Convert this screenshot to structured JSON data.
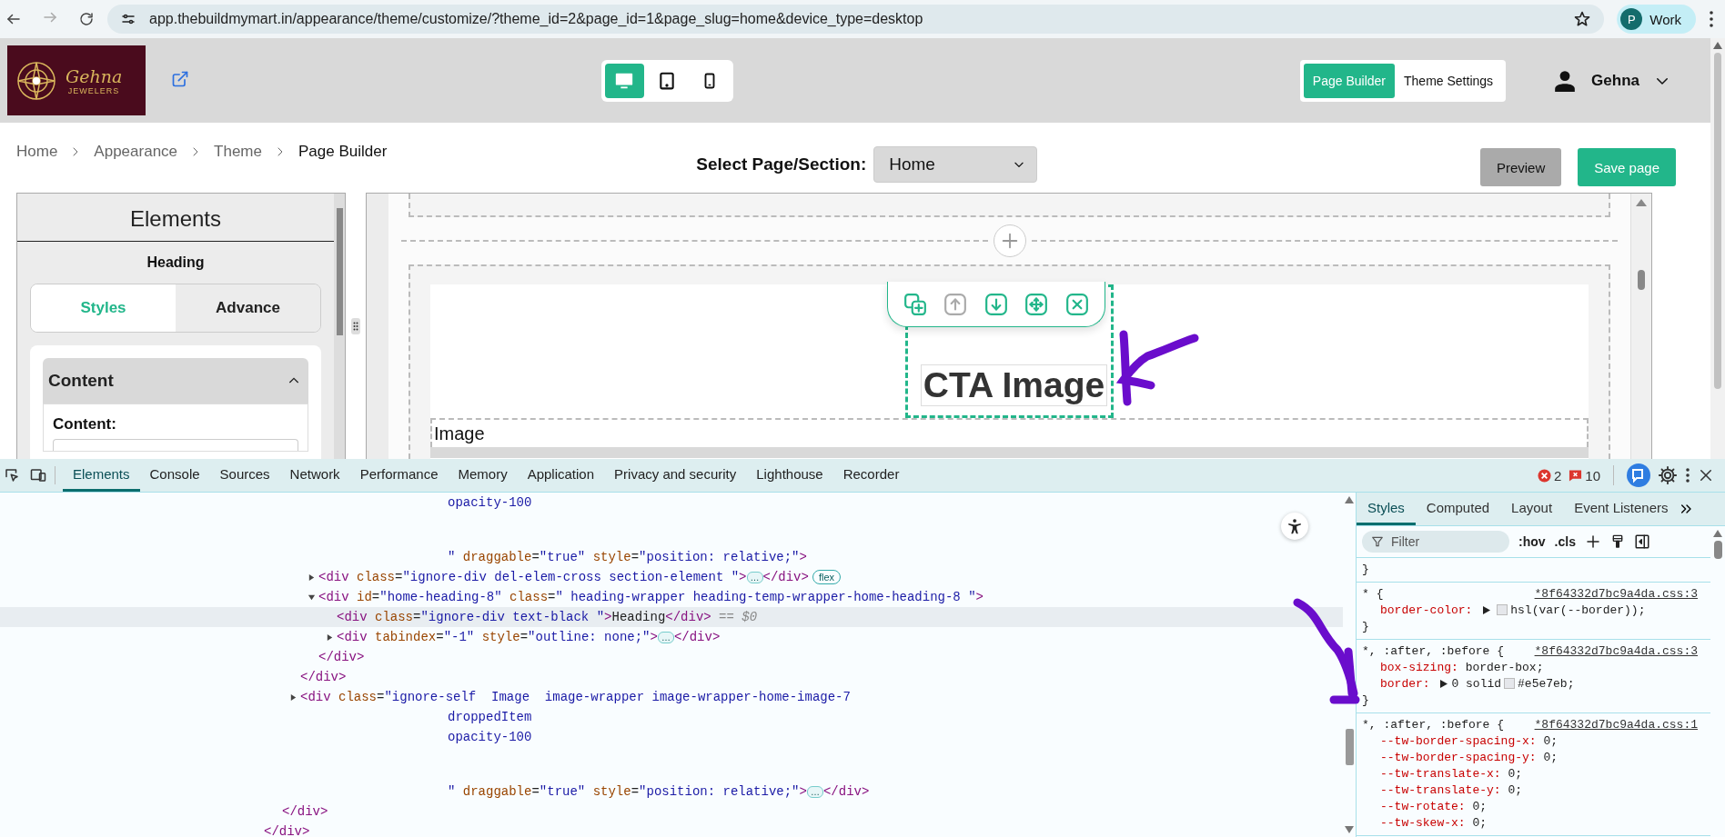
{
  "browser": {
    "url": "app.thebuildmymart.in/appearance/theme/customize/?theme_id=2&page_id=1&page_slug=home&device_type=desktop",
    "profile_initial": "P",
    "profile_label": "Work"
  },
  "header": {
    "logo_name": "Gehna",
    "logo_tagline": "JEWELERS",
    "devices": [
      {
        "kind": "desktop",
        "selected": true
      },
      {
        "kind": "tablet",
        "selected": false
      },
      {
        "kind": "mobile",
        "selected": false
      }
    ],
    "modes": [
      {
        "label": "Page Builder",
        "selected": true
      },
      {
        "label": "Theme Settings",
        "selected": false
      }
    ],
    "user": "Gehna"
  },
  "breadcrumb": [
    {
      "label": "Home",
      "current": false
    },
    {
      "label": "Appearance",
      "current": false
    },
    {
      "label": "Theme",
      "current": false
    },
    {
      "label": "Page Builder",
      "current": true
    }
  ],
  "page_select": {
    "label": "Select Page/Section:",
    "value": "Home"
  },
  "actions": [
    {
      "label": "Preview",
      "kind": "secondary"
    },
    {
      "label": "Save page",
      "kind": "primary"
    }
  ],
  "sidebar": {
    "title": "Elements",
    "subtitle": "Heading",
    "tabs": [
      {
        "label": "Styles",
        "selected": true
      },
      {
        "label": "Advance",
        "selected": false
      }
    ],
    "section": {
      "title": "Content",
      "expanded": true,
      "field_label": "Content:"
    }
  },
  "canvas": {
    "toolbar": [
      {
        "kind": "duplicate",
        "disabled": false
      },
      {
        "kind": "up",
        "disabled": true
      },
      {
        "kind": "down",
        "disabled": false
      },
      {
        "kind": "move",
        "disabled": false
      },
      {
        "kind": "delete",
        "disabled": false
      }
    ],
    "heading": "CTA Image",
    "image_label": "Image"
  },
  "devtools": {
    "tabs": [
      {
        "label": "Elements",
        "selected": true
      },
      {
        "label": "Console",
        "selected": false
      },
      {
        "label": "Sources",
        "selected": false
      },
      {
        "label": "Network",
        "selected": false
      },
      {
        "label": "Performance",
        "selected": false
      },
      {
        "label": "Memory",
        "selected": false
      },
      {
        "label": "Application",
        "selected": false
      },
      {
        "label": "Privacy and security",
        "selected": false
      },
      {
        "label": "Lighthouse",
        "selected": false
      },
      {
        "label": "Recorder",
        "selected": false
      }
    ],
    "errors": "2",
    "issues": "10",
    "tree": [
      {
        "close": "</div>",
        "children": [
          {
            "close": "</div>",
            "children": [
              {
                "selected": false,
                "close": "</div>",
                "open": [
                  {
                    "kind": "continuation",
                    "tokens": [
                      {
                        "kind": "value",
                        "text": "opacity-100"
                      }
                    ]
                  },
                  {
                    "kind": "blank"
                  },
                  {
                    "kind": "continuation",
                    "tokens": [
                      {
                        "kind": "value",
                        "text": "\""
                      },
                      {
                        "kind": "attr",
                        "text": " draggable"
                      },
                      {
                        "kind": "plain",
                        "text": "="
                      },
                      {
                        "kind": "value",
                        "text": "\"true\""
                      },
                      {
                        "kind": "attr",
                        "text": " style"
                      },
                      {
                        "kind": "plain",
                        "text": "="
                      },
                      {
                        "kind": "value",
                        "text": "\"position: relative;\""
                      },
                      {
                        "kind": "tag",
                        "text": ">"
                      }
                    ]
                  }
                ],
                "children": [
                  {
                    "selected": false,
                    "expanded": false,
                    "open": [
                      {
                        "kind": "tag",
                        "tokens": [
                          {
                            "kind": "tag",
                            "text": "<div"
                          },
                          {
                            "kind": "attr",
                            "text": " class"
                          },
                          {
                            "kind": "plain",
                            "text": "="
                          },
                          {
                            "kind": "value",
                            "text": "\"ignore-div del-elem-cross section-element \""
                          },
                          {
                            "kind": "tag",
                            "text": ">"
                          },
                          {
                            "kind": "ellipsis",
                            "text": "…"
                          },
                          {
                            "kind": "tag",
                            "text": "</div>"
                          },
                          {
                            "kind": "badge",
                            "text": "flex"
                          }
                        ]
                      }
                    ]
                  },
                  {
                    "selected": false,
                    "expanded": true,
                    "close": "</div>",
                    "open": [
                      {
                        "kind": "tag",
                        "tokens": [
                          {
                            "kind": "tag",
                            "text": "<div"
                          },
                          {
                            "kind": "attr",
                            "text": " id"
                          },
                          {
                            "kind": "plain",
                            "text": "="
                          },
                          {
                            "kind": "value",
                            "text": "\"home-heading-8\""
                          },
                          {
                            "kind": "attr",
                            "text": " class"
                          },
                          {
                            "kind": "plain",
                            "text": "="
                          },
                          {
                            "kind": "value",
                            "text": "\" heading-wrapper heading-temp-wrapper-home-heading-8 \""
                          },
                          {
                            "kind": "tag",
                            "text": ">"
                          }
                        ]
                      }
                    ],
                    "children": [
                      {
                        "selected": true,
                        "open": [
                          {
                            "kind": "tag",
                            "tokens": [
                              {
                                "kind": "tag",
                                "text": "<div"
                              },
                              {
                                "kind": "attr",
                                "text": " class"
                              },
                              {
                                "kind": "plain",
                                "text": "="
                              },
                              {
                                "kind": "value",
                                "text": "\"ignore-div text-black \""
                              },
                              {
                                "kind": "tag",
                                "text": ">"
                              },
                              {
                                "kind": "plain",
                                "text": "Heading"
                              },
                              {
                                "kind": "tag",
                                "text": "</div>"
                              },
                              {
                                "kind": "ref",
                                "text": " == $0"
                              }
                            ]
                          }
                        ]
                      },
                      {
                        "selected": false,
                        "expanded": false,
                        "open": [
                          {
                            "kind": "tag",
                            "tokens": [
                              {
                                "kind": "tag",
                                "text": "<div"
                              },
                              {
                                "kind": "attr",
                                "text": " tabindex"
                              },
                              {
                                "kind": "plain",
                                "text": "="
                              },
                              {
                                "kind": "value",
                                "text": "\"-1\""
                              },
                              {
                                "kind": "attr",
                                "text": " style"
                              },
                              {
                                "kind": "plain",
                                "text": "="
                              },
                              {
                                "kind": "value",
                                "text": "\"outline: none;\""
                              },
                              {
                                "kind": "tag",
                                "text": ">"
                              },
                              {
                                "kind": "ellipsis",
                                "text": "…"
                              },
                              {
                                "kind": "tag",
                                "text": "</div>"
                              }
                            ]
                          }
                        ]
                      }
                    ]
                  }
                ]
              },
              {
                "selected": false,
                "expanded": false,
                "open": [
                  {
                    "kind": "tag",
                    "tokens": [
                      {
                        "kind": "tag",
                        "text": "<div"
                      },
                      {
                        "kind": "attr",
                        "text": " class"
                      },
                      {
                        "kind": "plain",
                        "text": "="
                      },
                      {
                        "kind": "value",
                        "text": "\"ignore-self  Image  image-wrapper image-wrapper-home-image-7"
                      }
                    ]
                  },
                  {
                    "kind": "continuation",
                    "tokens": [
                      {
                        "kind": "value",
                        "text": "droppedItem"
                      }
                    ]
                  },
                  {
                    "kind": "continuation",
                    "tokens": [
                      {
                        "kind": "value",
                        "text": "opacity-100"
                      }
                    ]
                  },
                  {
                    "kind": "blank"
                  },
                  {
                    "kind": "continuation",
                    "tokens": [
                      {
                        "kind": "value",
                        "text": "\""
                      },
                      {
                        "kind": "attr",
                        "text": " draggable"
                      },
                      {
                        "kind": "plain",
                        "text": "="
                      },
                      {
                        "kind": "value",
                        "text": "\"true\""
                      },
                      {
                        "kind": "attr",
                        "text": " style"
                      },
                      {
                        "kind": "plain",
                        "text": "="
                      },
                      {
                        "kind": "value",
                        "text": "\"position: relative;\""
                      },
                      {
                        "kind": "tag",
                        "text": ">"
                      },
                      {
                        "kind": "ellipsis",
                        "text": "…"
                      },
                      {
                        "kind": "tag",
                        "text": "</div>"
                      }
                    ]
                  }
                ]
              }
            ]
          }
        ]
      }
    ],
    "styles": {
      "tabs": [
        {
          "label": "Styles",
          "selected": true
        },
        {
          "label": "Computed",
          "selected": false
        },
        {
          "label": "Layout",
          "selected": false
        },
        {
          "label": "Event Listeners",
          "selected": false
        }
      ],
      "filter_placeholder": "Filter",
      "toggles": [
        ":hov",
        ".cls"
      ],
      "rules": [
        {
          "close": "}"
        },
        {
          "selector": "*",
          "open": "{",
          "source": "*8f64332d7bc9a4da.css:3",
          "close": "}",
          "declarations": [
            {
              "name": "border-color:",
              "value": "hsl(var(--border));",
              "expandable": true,
              "color": "#e5e7eb"
            }
          ]
        },
        {
          "selector": "*, :after, :before",
          "open": "{",
          "source": "*8f64332d7bc9a4da.css:3",
          "close": "}",
          "declarations": [
            {
              "name": "box-sizing:",
              "value": "border-box;"
            },
            {
              "name": "border:",
              "value": "0 solid",
              "expandable": true,
              "color": "#e5e7eb",
              "after": "#e5e7eb;"
            }
          ]
        },
        {
          "selector": "*, :after, :before",
          "open": "{",
          "source": "*8f64332d7bc9a4da.css:1",
          "declarations": [
            {
              "name": "--tw-border-spacing-x:",
              "value": "0;"
            },
            {
              "name": "--tw-border-spacing-y:",
              "value": "0;"
            },
            {
              "name": "--tw-translate-x:",
              "value": "0;"
            },
            {
              "name": "--tw-translate-y:",
              "value": "0;"
            },
            {
              "name": "--tw-rotate:",
              "value": "0;"
            },
            {
              "name": "--tw-skew-x:",
              "value": "0;"
            }
          ]
        }
      ]
    }
  }
}
